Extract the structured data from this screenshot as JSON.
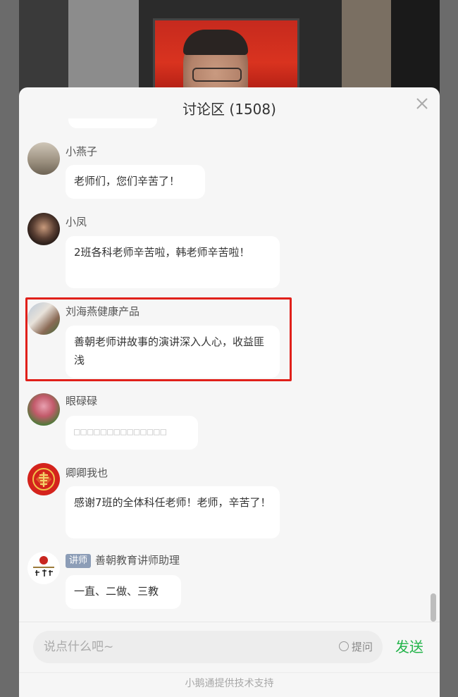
{
  "header": {
    "title": "讨论区 (1508)"
  },
  "icons": {
    "close": "close-icon"
  },
  "messages": [
    {
      "name": "小燕子",
      "text": "老师们，您们辛苦了！"
    },
    {
      "name": "小凤",
      "text": "2班各科老师辛苦啦，韩老师辛苦啦！"
    },
    {
      "name": "刘海燕健康产品",
      "text": "善朝老师讲故事的演讲深入人心，收益匪浅"
    },
    {
      "name": "眼碌碌",
      "text": "□□□□□□□□□□□□□□"
    },
    {
      "name": "卿卿我也",
      "text": "感谢7班的全体科任老师！老师，辛苦了！"
    },
    {
      "badge": "讲师",
      "name": "善朝教育讲师助理",
      "text": "一直、二做、三教"
    }
  ],
  "input": {
    "placeholder": "说点什么吧~",
    "ask_label": "提问",
    "send_label": "发送"
  },
  "footer": {
    "text": "小鹅通提供技术支持"
  },
  "colors": {
    "send": "#23b44a",
    "highlight": "#e0201a",
    "badge": "#8c9db7"
  }
}
